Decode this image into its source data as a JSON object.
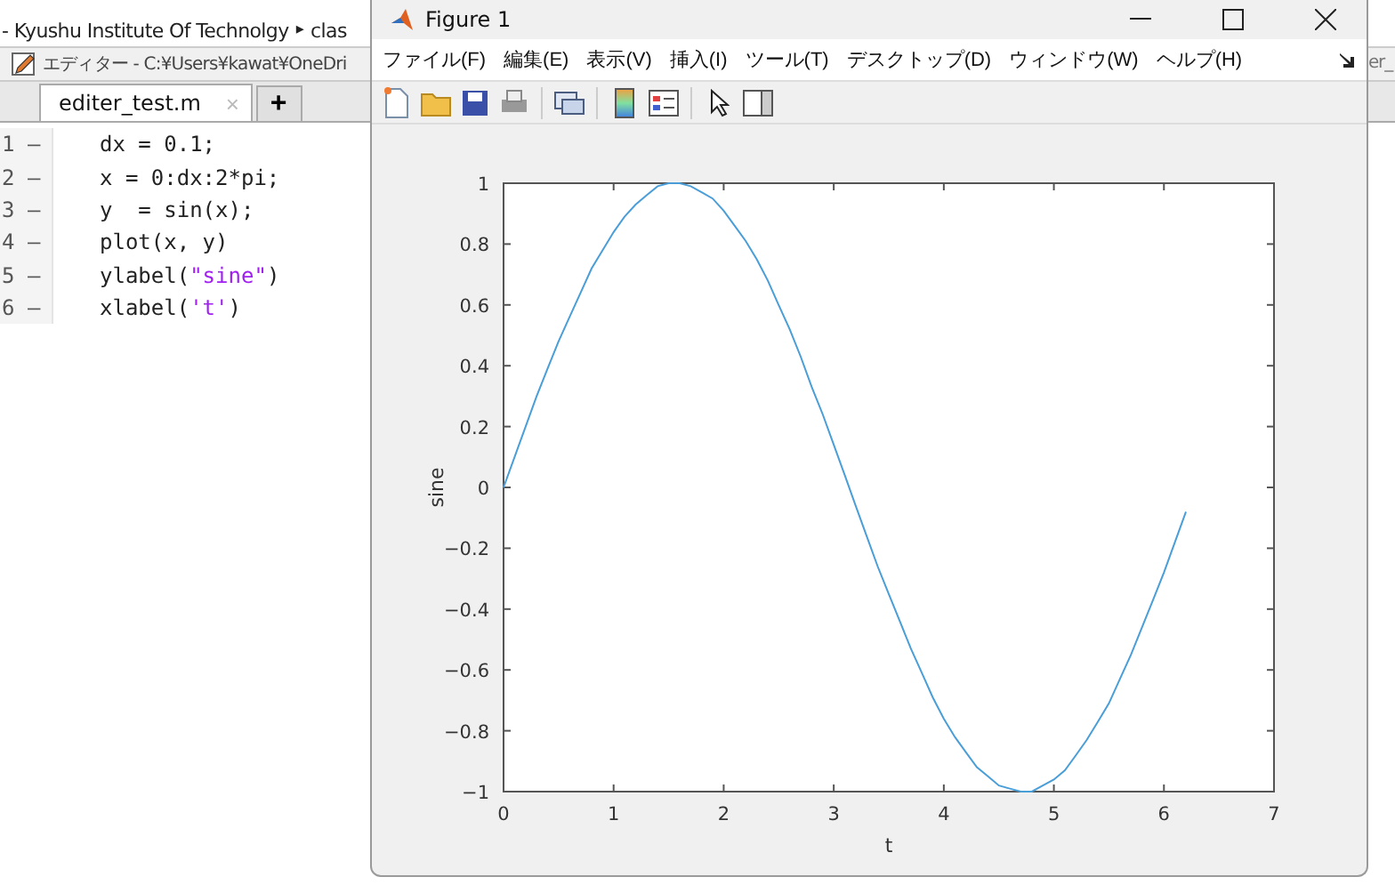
{
  "breadcrumb": {
    "text": "- Kyushu Institute Of Technolgy",
    "separator": "▸",
    "next": "clas"
  },
  "editor": {
    "title": "エディター - C:¥Users¥kawat¥OneDri",
    "tabs": [
      {
        "label": "editer_test.m",
        "selected": true,
        "close": "×"
      }
    ],
    "add_tab": "+",
    "lines": [
      {
        "number": "1",
        "marker": "—",
        "segments": [
          {
            "kind": "plain",
            "text": "dx = 0.1;"
          }
        ]
      },
      {
        "number": "2",
        "marker": "—",
        "segments": [
          {
            "kind": "plain",
            "text": "x = 0:dx:2*pi;"
          }
        ]
      },
      {
        "number": "3",
        "marker": "—",
        "segments": [
          {
            "kind": "plain",
            "text": "y  = sin(x);"
          }
        ]
      },
      {
        "number": "4",
        "marker": "—",
        "segments": [
          {
            "kind": "plain",
            "text": "plot(x, y)"
          }
        ]
      },
      {
        "number": "5",
        "marker": "—",
        "segments": [
          {
            "kind": "plain",
            "text": "ylabel("
          },
          {
            "kind": "string",
            "text": "\"sine\""
          },
          {
            "kind": "plain",
            "text": ")"
          }
        ]
      },
      {
        "number": "6",
        "marker": "—",
        "segments": [
          {
            "kind": "plain",
            "text": "xlabel("
          },
          {
            "kind": "string",
            "text": "'t'"
          },
          {
            "kind": "plain",
            "text": ")"
          }
        ]
      }
    ]
  },
  "behind_text": "er_",
  "figure": {
    "title": "Figure 1",
    "menu": [
      "ファイル(F)",
      "編集(E)",
      "表示(V)",
      "挿入(I)",
      "ツール(T)",
      "デスクトップ(D)",
      "ウィンドウ(W)",
      "ヘルプ(H)"
    ],
    "toolbar": [
      {
        "kind": "new"
      },
      {
        "kind": "open"
      },
      {
        "kind": "save"
      },
      {
        "kind": "print"
      },
      {
        "kind": "sep"
      },
      {
        "kind": "link"
      },
      {
        "kind": "sep"
      },
      {
        "kind": "colorbar"
      },
      {
        "kind": "legend"
      },
      {
        "kind": "sep"
      },
      {
        "kind": "pointer"
      },
      {
        "kind": "inspector"
      }
    ],
    "chart_data": {
      "type": "line",
      "xlabel": "t",
      "ylabel": "sine",
      "xlim": [
        0,
        7
      ],
      "ylim": [
        -1,
        1
      ],
      "xticks": [
        0,
        1,
        2,
        3,
        4,
        5,
        6,
        7
      ],
      "yticks": [
        {
          "value": -1,
          "label": "−1"
        },
        {
          "value": -0.8,
          "label": "−0.8"
        },
        {
          "value": -0.6,
          "label": "−0.6"
        },
        {
          "value": -0.4,
          "label": "−0.4"
        },
        {
          "value": -0.2,
          "label": "−0.2"
        },
        {
          "value": 0,
          "label": "0"
        },
        {
          "value": 0.2,
          "label": "0.2"
        },
        {
          "value": 0.4,
          "label": "0.4"
        },
        {
          "value": 0.6,
          "label": "0.6"
        },
        {
          "value": 0.8,
          "label": "0.8"
        },
        {
          "value": 1,
          "label": "1"
        }
      ],
      "x": [
        0,
        0.1,
        0.2,
        0.3,
        0.4,
        0.5,
        0.6,
        0.7,
        0.8,
        0.9,
        1,
        1.1,
        1.2,
        1.3,
        1.4,
        1.5,
        1.6,
        1.7,
        1.8,
        1.9,
        2,
        2.1,
        2.2,
        2.3,
        2.4,
        2.5,
        2.6,
        2.7,
        2.8,
        2.9,
        3,
        3.1,
        3.2,
        3.3,
        3.4,
        3.5,
        3.6,
        3.7,
        3.8,
        3.9,
        4,
        4.1,
        4.2,
        4.3,
        4.4,
        4.5,
        4.6,
        4.7,
        4.8,
        4.9,
        5,
        5.1,
        5.2,
        5.3,
        5.4,
        5.5,
        5.6,
        5.7,
        5.8,
        5.9,
        6,
        6.1,
        6.2
      ],
      "series": [
        {
          "color": "#4a9ed8",
          "values": [
            0,
            0.1,
            0.2,
            0.3,
            0.39,
            0.48,
            0.56,
            0.64,
            0.72,
            0.78,
            0.84,
            0.89,
            0.93,
            0.96,
            0.99,
            1,
            1,
            0.99,
            0.97,
            0.95,
            0.91,
            0.86,
            0.81,
            0.75,
            0.68,
            0.6,
            0.52,
            0.43,
            0.33,
            0.24,
            0.14,
            0.04,
            -0.06,
            -0.16,
            -0.26,
            -0.35,
            -0.44,
            -0.53,
            -0.61,
            -0.69,
            -0.76,
            -0.82,
            -0.87,
            -0.92,
            -0.95,
            -0.98,
            -0.99,
            -1,
            -1,
            -0.98,
            -0.96,
            -0.93,
            -0.88,
            -0.83,
            -0.77,
            -0.71,
            -0.63,
            -0.55,
            -0.46,
            -0.37,
            -0.28,
            -0.18,
            -0.08
          ]
        }
      ]
    }
  }
}
